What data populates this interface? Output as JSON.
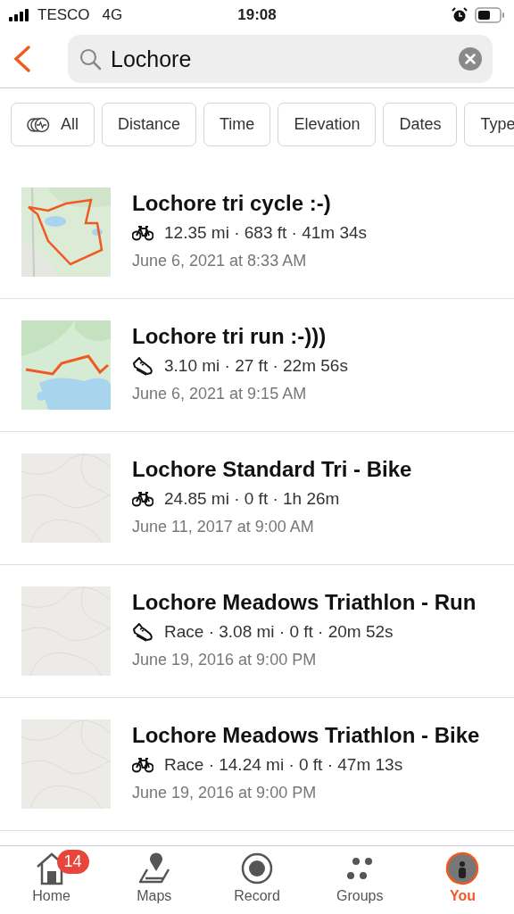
{
  "status_bar": {
    "carrier": "TESCO",
    "network": "4G",
    "time": "19:08"
  },
  "search": {
    "value": "Lochore"
  },
  "filters": [
    {
      "label": "All",
      "kind": "icon"
    },
    {
      "label": "Distance",
      "kind": "plain"
    },
    {
      "label": "Time",
      "kind": "plain"
    },
    {
      "label": "Elevation",
      "kind": "plain"
    },
    {
      "label": "Dates",
      "kind": "plain"
    },
    {
      "label": "Type",
      "kind": "plain"
    }
  ],
  "activities": [
    {
      "title": "Lochore tri cycle :-)",
      "kind": "ride",
      "stats": "12.35 mi · 683 ft · 41m 34s",
      "date": "June 6, 2021 at 8:33 AM"
    },
    {
      "title": "Lochore tri run :-)))",
      "kind": "run",
      "stats": "3.10 mi · 27 ft · 22m 56s",
      "date": "June 6, 2021 at 9:15 AM"
    },
    {
      "title": "Lochore Standard Tri - Bike",
      "kind": "ride",
      "stats": "24.85 mi · 0 ft · 1h 26m",
      "date": "June 11, 2017 at 9:00 AM"
    },
    {
      "title": "Lochore Meadows Triathlon - Run",
      "kind": "run",
      "stats": "Race · 3.08 mi · 0 ft · 20m 52s",
      "date": "June 19, 2016 at 9:00 PM"
    },
    {
      "title": "Lochore Meadows Triathlon - Bike",
      "kind": "ride",
      "stats": "Race · 14.24 mi · 0 ft · 47m 13s",
      "date": "June 19, 2016 at 9:00 PM"
    }
  ],
  "tab_bar": [
    {
      "label": "Home",
      "badge": "14",
      "selected": false
    },
    {
      "label": "Maps",
      "selected": false
    },
    {
      "label": "Record",
      "selected": false
    },
    {
      "label": "Groups",
      "selected": false
    },
    {
      "label": "You",
      "selected": true
    }
  ]
}
